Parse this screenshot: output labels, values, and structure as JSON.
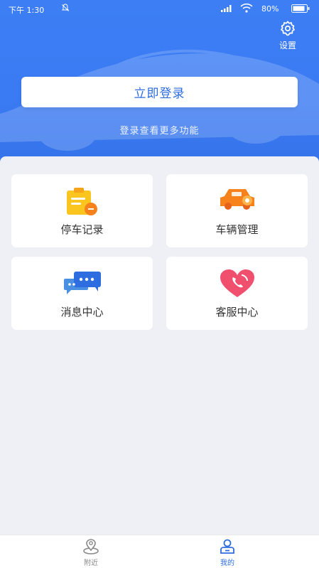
{
  "status_bar": {
    "time": "下午 1:30",
    "battery_percent": "80%",
    "icons": [
      "bell-icon",
      "signal-icon",
      "wifi-icon",
      "battery-icon"
    ]
  },
  "header": {
    "settings_label": "设置",
    "login_button": "立即登录",
    "login_hint": "登录查看更多功能"
  },
  "menu": {
    "items": [
      {
        "label": "停车记录",
        "icon": "clipboard-icon"
      },
      {
        "label": "车辆管理",
        "icon": "car-icon"
      },
      {
        "label": "消息中心",
        "icon": "chat-icon"
      },
      {
        "label": "客服中心",
        "icon": "heart-phone-icon"
      }
    ]
  },
  "tab_bar": {
    "tabs": [
      {
        "label": "附近",
        "icon": "location-pin-icon",
        "active": false
      },
      {
        "label": "我的",
        "icon": "user-icon",
        "active": true
      }
    ]
  },
  "colors": {
    "primary": "#3a7af2",
    "background": "#eff0f5",
    "active_tab": "#2e6de0",
    "orange": "#f7821b",
    "yellow": "#f9c51e",
    "heart": "#f0506e"
  }
}
